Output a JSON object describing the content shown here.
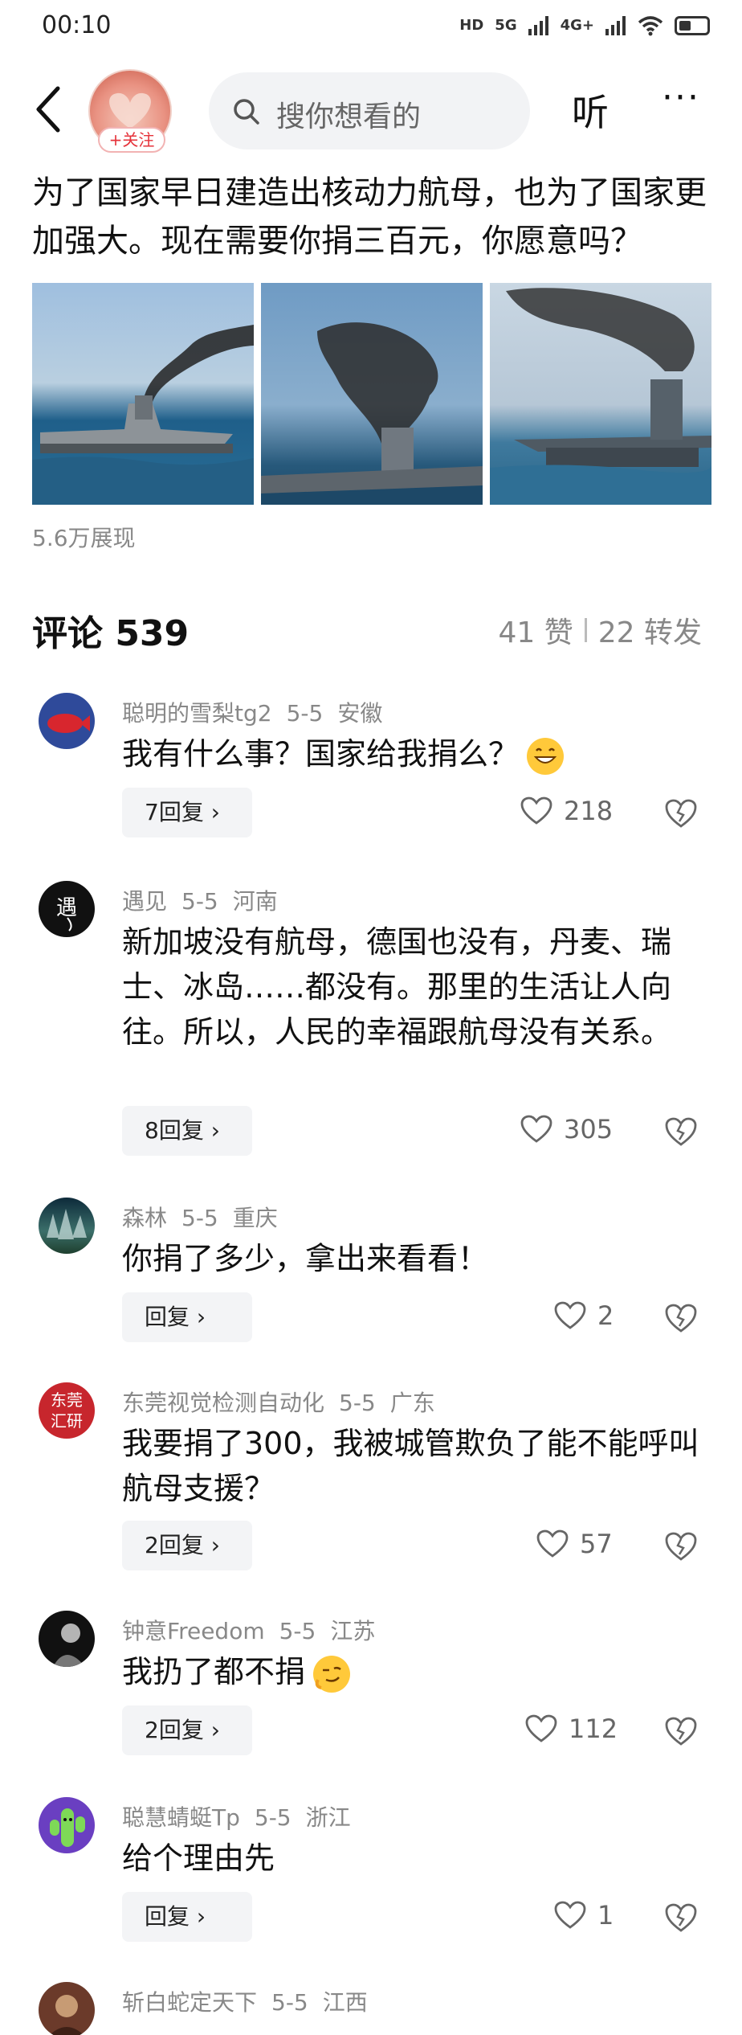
{
  "status_bar": {
    "time": "00:10",
    "icons": [
      "HD",
      "5G",
      "4G+"
    ]
  },
  "top_bar": {
    "follow_label": "+关注",
    "search_placeholder": "搜你想看的",
    "listen_label": "听",
    "more_label": "···"
  },
  "post": {
    "text": "为了国家早日建造出核动力航母，也为了国家更加强大。现在需要你捐三百元，你愿意吗？",
    "views": "5.6万展现"
  },
  "comments_header": {
    "title": "评论 539",
    "likes": "41 赞",
    "shares": "22 转发"
  },
  "comments": [
    {
      "user": "聪明的雪梨tg2",
      "date": "5-5",
      "location": "安徽",
      "text": "我有什么事？国家给我捐么？",
      "reply_label": "7回复 ›",
      "likes": "218"
    },
    {
      "user": "遇见",
      "date": "5-5",
      "location": "河南",
      "text": "新加坡没有航母，德国也没有，丹麦、瑞士、冰岛……都没有。那里的生活让人向往。所以，人民的幸福跟航母没有关系。",
      "reply_label": "8回复 ›",
      "likes": "305"
    },
    {
      "user": "森林",
      "date": "5-5",
      "location": "重庆",
      "text": "你捐了多少，拿出来看看！",
      "reply_label": "回复 ›",
      "likes": "2"
    },
    {
      "user": "东莞视觉检测自动化",
      "date": "5-5",
      "location": "广东",
      "text": "我要捐了300，我被城管欺负了能不能呼叫航母支援？",
      "reply_label": "2回复 ›",
      "likes": "57",
      "avatar_text": "东莞汇研"
    },
    {
      "user": "钟意Freedom",
      "date": "5-5",
      "location": "江苏",
      "text": "我扔了都不捐",
      "reply_label": "2回复 ›",
      "likes": "112"
    },
    {
      "user": "聪慧蜻蜓Tp",
      "date": "5-5",
      "location": "浙江",
      "text": "给个理由先",
      "reply_label": "回复 ›",
      "likes": "1"
    },
    {
      "user": "斩白蛇定天下",
      "date": "5-5",
      "location": "江西"
    }
  ]
}
